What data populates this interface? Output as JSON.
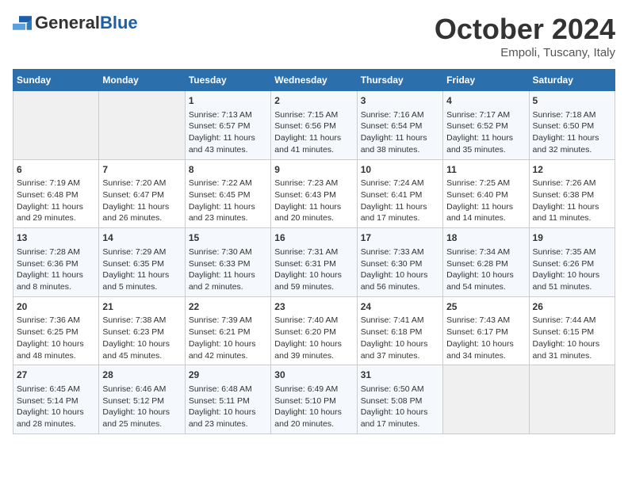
{
  "header": {
    "logo_general": "General",
    "logo_blue": "Blue",
    "month": "October 2024",
    "location": "Empoli, Tuscany, Italy"
  },
  "days_of_week": [
    "Sunday",
    "Monday",
    "Tuesday",
    "Wednesday",
    "Thursday",
    "Friday",
    "Saturday"
  ],
  "weeks": [
    [
      {
        "day": "",
        "content": ""
      },
      {
        "day": "",
        "content": ""
      },
      {
        "day": "1",
        "content": "Sunrise: 7:13 AM\nSunset: 6:57 PM\nDaylight: 11 hours and 43 minutes."
      },
      {
        "day": "2",
        "content": "Sunrise: 7:15 AM\nSunset: 6:56 PM\nDaylight: 11 hours and 41 minutes."
      },
      {
        "day": "3",
        "content": "Sunrise: 7:16 AM\nSunset: 6:54 PM\nDaylight: 11 hours and 38 minutes."
      },
      {
        "day": "4",
        "content": "Sunrise: 7:17 AM\nSunset: 6:52 PM\nDaylight: 11 hours and 35 minutes."
      },
      {
        "day": "5",
        "content": "Sunrise: 7:18 AM\nSunset: 6:50 PM\nDaylight: 11 hours and 32 minutes."
      }
    ],
    [
      {
        "day": "6",
        "content": "Sunrise: 7:19 AM\nSunset: 6:48 PM\nDaylight: 11 hours and 29 minutes."
      },
      {
        "day": "7",
        "content": "Sunrise: 7:20 AM\nSunset: 6:47 PM\nDaylight: 11 hours and 26 minutes."
      },
      {
        "day": "8",
        "content": "Sunrise: 7:22 AM\nSunset: 6:45 PM\nDaylight: 11 hours and 23 minutes."
      },
      {
        "day": "9",
        "content": "Sunrise: 7:23 AM\nSunset: 6:43 PM\nDaylight: 11 hours and 20 minutes."
      },
      {
        "day": "10",
        "content": "Sunrise: 7:24 AM\nSunset: 6:41 PM\nDaylight: 11 hours and 17 minutes."
      },
      {
        "day": "11",
        "content": "Sunrise: 7:25 AM\nSunset: 6:40 PM\nDaylight: 11 hours and 14 minutes."
      },
      {
        "day": "12",
        "content": "Sunrise: 7:26 AM\nSunset: 6:38 PM\nDaylight: 11 hours and 11 minutes."
      }
    ],
    [
      {
        "day": "13",
        "content": "Sunrise: 7:28 AM\nSunset: 6:36 PM\nDaylight: 11 hours and 8 minutes."
      },
      {
        "day": "14",
        "content": "Sunrise: 7:29 AM\nSunset: 6:35 PM\nDaylight: 11 hours and 5 minutes."
      },
      {
        "day": "15",
        "content": "Sunrise: 7:30 AM\nSunset: 6:33 PM\nDaylight: 11 hours and 2 minutes."
      },
      {
        "day": "16",
        "content": "Sunrise: 7:31 AM\nSunset: 6:31 PM\nDaylight: 10 hours and 59 minutes."
      },
      {
        "day": "17",
        "content": "Sunrise: 7:33 AM\nSunset: 6:30 PM\nDaylight: 10 hours and 56 minutes."
      },
      {
        "day": "18",
        "content": "Sunrise: 7:34 AM\nSunset: 6:28 PM\nDaylight: 10 hours and 54 minutes."
      },
      {
        "day": "19",
        "content": "Sunrise: 7:35 AM\nSunset: 6:26 PM\nDaylight: 10 hours and 51 minutes."
      }
    ],
    [
      {
        "day": "20",
        "content": "Sunrise: 7:36 AM\nSunset: 6:25 PM\nDaylight: 10 hours and 48 minutes."
      },
      {
        "day": "21",
        "content": "Sunrise: 7:38 AM\nSunset: 6:23 PM\nDaylight: 10 hours and 45 minutes."
      },
      {
        "day": "22",
        "content": "Sunrise: 7:39 AM\nSunset: 6:21 PM\nDaylight: 10 hours and 42 minutes."
      },
      {
        "day": "23",
        "content": "Sunrise: 7:40 AM\nSunset: 6:20 PM\nDaylight: 10 hours and 39 minutes."
      },
      {
        "day": "24",
        "content": "Sunrise: 7:41 AM\nSunset: 6:18 PM\nDaylight: 10 hours and 37 minutes."
      },
      {
        "day": "25",
        "content": "Sunrise: 7:43 AM\nSunset: 6:17 PM\nDaylight: 10 hours and 34 minutes."
      },
      {
        "day": "26",
        "content": "Sunrise: 7:44 AM\nSunset: 6:15 PM\nDaylight: 10 hours and 31 minutes."
      }
    ],
    [
      {
        "day": "27",
        "content": "Sunrise: 6:45 AM\nSunset: 5:14 PM\nDaylight: 10 hours and 28 minutes."
      },
      {
        "day": "28",
        "content": "Sunrise: 6:46 AM\nSunset: 5:12 PM\nDaylight: 10 hours and 25 minutes."
      },
      {
        "day": "29",
        "content": "Sunrise: 6:48 AM\nSunset: 5:11 PM\nDaylight: 10 hours and 23 minutes."
      },
      {
        "day": "30",
        "content": "Sunrise: 6:49 AM\nSunset: 5:10 PM\nDaylight: 10 hours and 20 minutes."
      },
      {
        "day": "31",
        "content": "Sunrise: 6:50 AM\nSunset: 5:08 PM\nDaylight: 10 hours and 17 minutes."
      },
      {
        "day": "",
        "content": ""
      },
      {
        "day": "",
        "content": ""
      }
    ]
  ]
}
